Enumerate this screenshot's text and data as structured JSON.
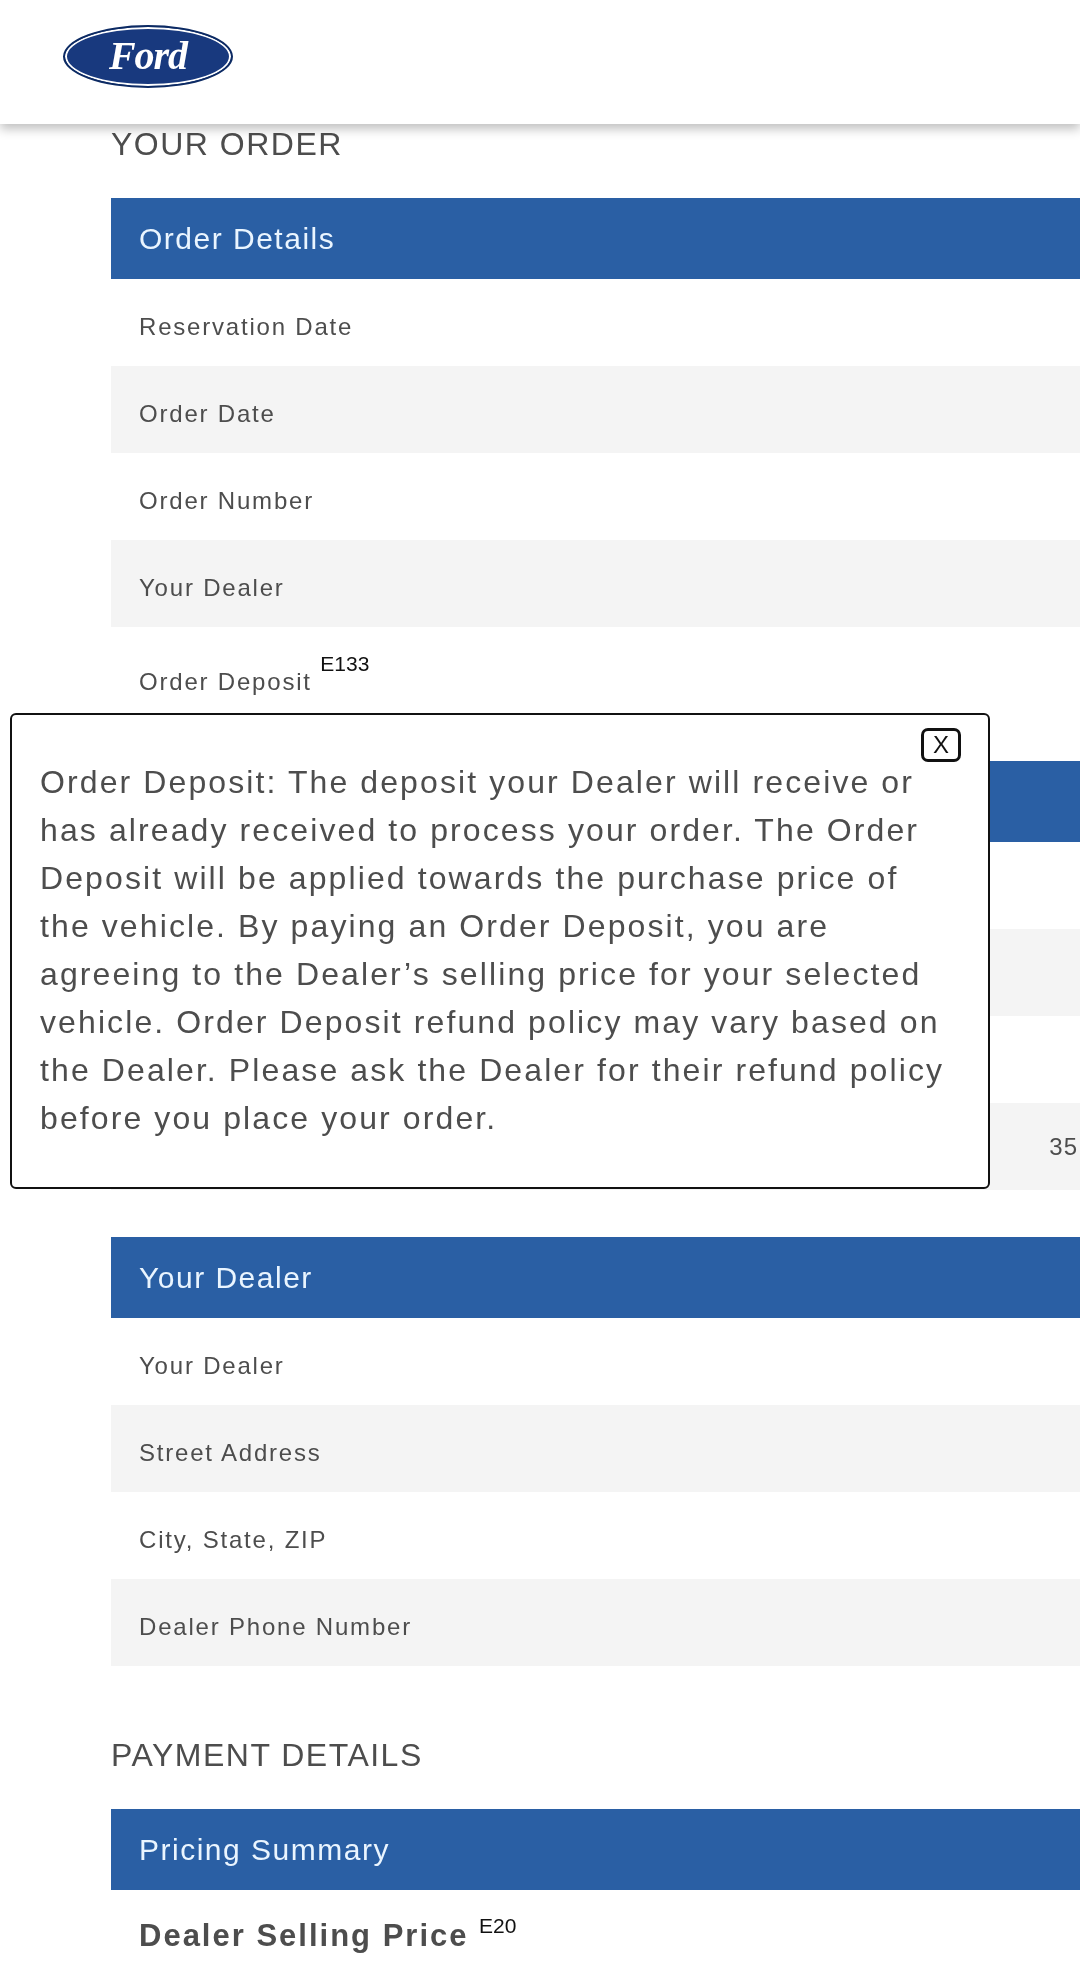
{
  "header": {
    "logo": "Ford"
  },
  "order": {
    "heading": "YOUR ORDER",
    "sections": [
      {
        "title": "Order Details",
        "rows": [
          {
            "label": "Reservation Date"
          },
          {
            "label": "Order Date"
          },
          {
            "label": "Order Number"
          },
          {
            "label": "Your Dealer"
          },
          {
            "label": "Order Deposit $^{E133}$"
          }
        ]
      },
      {
        "rows": [
          {},
          {},
          {},
          {
            "value": "35"
          }
        ]
      },
      {
        "title": "Your Dealer",
        "rows": [
          {
            "label": "Your Dealer"
          },
          {
            "label": "Street Address"
          },
          {
            "label": "City, State, ZIP"
          },
          {
            "label": "Dealer Phone Number"
          }
        ]
      }
    ]
  },
  "payment": {
    "heading": "PAYMENT DETAILS",
    "sections": [
      {
        "title": "Pricing Summary",
        "rows": [
          {
            "label": "Dealer Selling Price $^{E20}$",
            "kind": "total"
          }
        ]
      }
    ]
  },
  "tooltip": {
    "text": "Order Deposit: The deposit your Dealer will receive or has already received to process your order. The Order Deposit will be applied towards the purchase price of the vehicle. By paying an Order Deposit, you are agreeing to the Dealer’s selling price for your selected vehicle. Order Deposit refund policy may vary based on the Dealer. Please ask the Dealer for their refund policy before you place your order.",
    "close_label": "X"
  }
}
